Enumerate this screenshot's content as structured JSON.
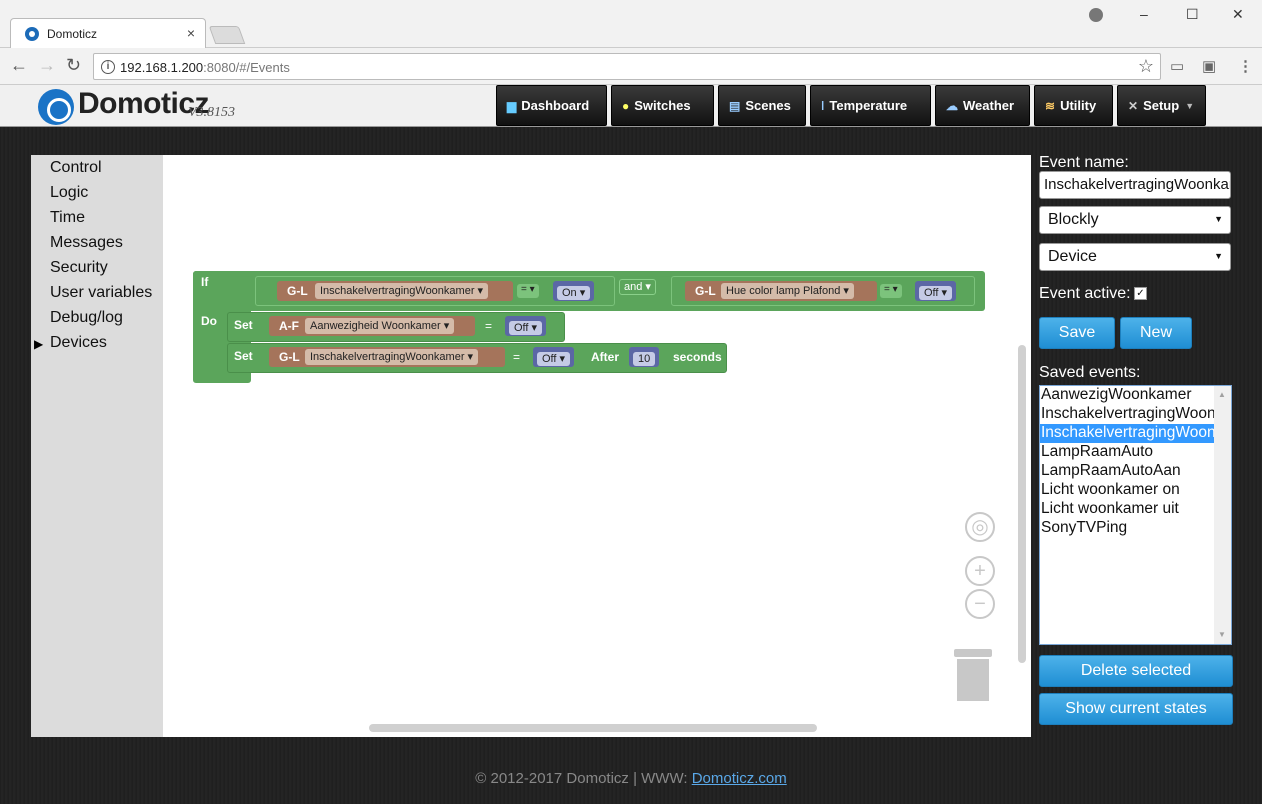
{
  "browser": {
    "tab_title": "Domoticz",
    "tab_close": "×",
    "url_host": "192.168.1.200",
    "url_rest": ":8080/#/Events",
    "window_controls": [
      "–",
      "☐",
      "✕"
    ]
  },
  "header": {
    "logo_text": "Domoticz",
    "version": "V3.8153",
    "nav": [
      {
        "label": "Dashboard",
        "icon": "dashboard-icon"
      },
      {
        "label": "Switches",
        "icon": "bulb-icon"
      },
      {
        "label": "Scenes",
        "icon": "scenes-icon"
      },
      {
        "label": "Temperature",
        "icon": "thermometer-icon"
      },
      {
        "label": "Weather",
        "icon": "weather-icon"
      },
      {
        "label": "Utility",
        "icon": "utility-icon"
      },
      {
        "label": "Setup",
        "icon": "tools-icon"
      }
    ]
  },
  "sidebar": {
    "categories": [
      "Control",
      "Logic",
      "Time",
      "Messages",
      "Security",
      "User variables",
      "Debug/log",
      "Devices"
    ],
    "expanded": "Devices"
  },
  "blocks": {
    "if_label": "If",
    "do_label": "Do",
    "cond1": {
      "type": "G-L",
      "device": "InschakelvertragingWoonkamer",
      "op": "=",
      "state": "On"
    },
    "and_label": "and",
    "cond2": {
      "type": "G-L",
      "device": "Hue color lamp Plafond",
      "op": "=",
      "state": "Off"
    },
    "set1": {
      "set_label": "Set",
      "type": "A-F",
      "device": "Aanwezigheid Woonkamer",
      "op": "=",
      "state": "Off"
    },
    "set2": {
      "set_label": "Set",
      "type": "G-L",
      "device": "InschakelvertragingWoonkamer",
      "op": "=",
      "state": "Off",
      "after_label": "After",
      "delay": "10",
      "unit": "seconds"
    }
  },
  "right_panel": {
    "event_name_label": "Event name:",
    "event_name_value": "InschakelvertragingWoonkamer",
    "type_select": "Blockly",
    "kind_select": "Device",
    "event_active_label": "Event active:",
    "event_active_checked": true,
    "save_label": "Save",
    "new_label": "New",
    "saved_events_label": "Saved events:",
    "saved_events": [
      "AanwezigWoonkamer",
      "InschakelvertragingWoonkamer",
      "InschakelvertragingWoonkamer",
      "LampRaamAuto",
      "LampRaamAutoAan",
      "Licht woonkamer on",
      "Licht woonkamer uit",
      "SonyTVPing"
    ],
    "selected_index": 2,
    "delete_label": "Delete selected",
    "show_states_label": "Show current states"
  },
  "footer": {
    "text": "© 2012-2017 Domoticz | WWW: ",
    "link": "Domoticz.com"
  },
  "colors": {
    "block_green": "#5ba55b",
    "device_brown": "#a5745b",
    "state_blue": "#5b67a5",
    "button_blue": "#1f8ed3",
    "selection_blue": "#3399ff"
  }
}
